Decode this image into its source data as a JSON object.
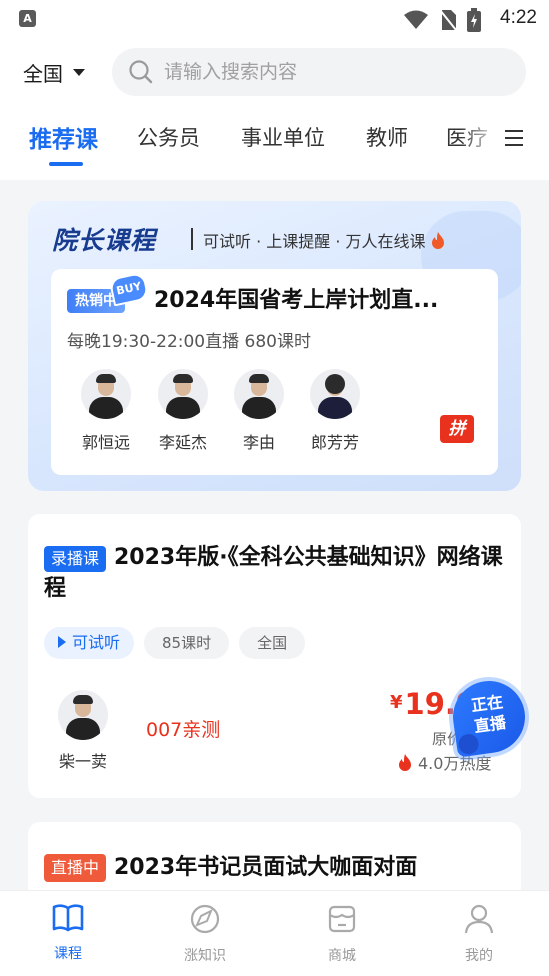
{
  "status_bar": {
    "time": "4:22"
  },
  "header": {
    "region": "全国",
    "search_placeholder": "请输入搜索内容"
  },
  "tabs": [
    {
      "label": "推荐课",
      "active": true
    },
    {
      "label": "公务员"
    },
    {
      "label": "事业单位"
    },
    {
      "label": "教师"
    },
    {
      "label": "医疗"
    }
  ],
  "promo": {
    "title": "院长课程",
    "subtitle": "可试听 · 上课提醒 · 万人在线课",
    "badge_hot": "热销中",
    "badge_buy": "BUY",
    "course_title": "2024年国省考上岸计划直...",
    "schedule": "每晚19:30-22:00直播 680课时",
    "teachers": [
      "郭恒远",
      "李延杰",
      "李由",
      "郎芳芳"
    ],
    "pin_label": "拼"
  },
  "course_card": {
    "tag": "录播课",
    "title": "2023年版·《全科公共基础知识》网络课程",
    "pills": [
      "可试听",
      "85课时",
      "全国"
    ],
    "teacher": "柴一荬",
    "note": "007亲测",
    "price_symbol": "¥",
    "price": "19.9",
    "original_label": "原价",
    "heat": "4.0万热度"
  },
  "live_float": {
    "line1": "正在",
    "line2": "直播"
  },
  "live_card": {
    "tag": "直播中",
    "title": "2023年书记员面试大咖面对面"
  },
  "bottom_nav": [
    {
      "label": "课程",
      "icon": "book-icon",
      "active": true
    },
    {
      "label": "涨知识",
      "icon": "compass-icon"
    },
    {
      "label": "商城",
      "icon": "store-icon"
    },
    {
      "label": "我的",
      "icon": "user-icon"
    }
  ],
  "colors": {
    "accent": "#1a6cf0",
    "price_red": "#e8321e",
    "live_tag": "#ee5a3a"
  }
}
